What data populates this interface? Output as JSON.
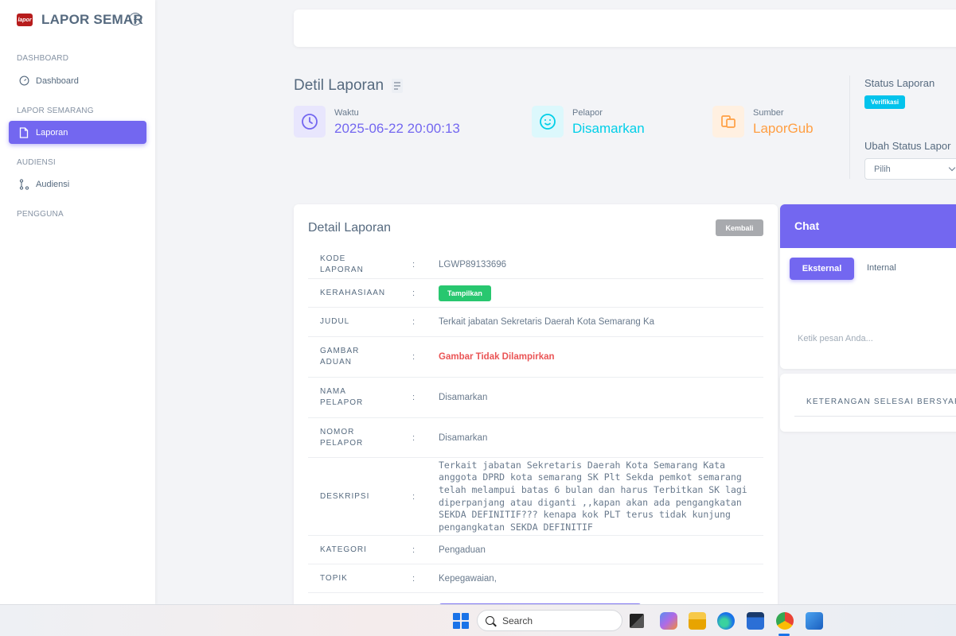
{
  "brand": {
    "name": "LAPOR SEMAR",
    "logo_text": "lapor"
  },
  "sidebar": {
    "sections": [
      {
        "header": "DASHBOARD",
        "items": [
          {
            "label": "Dashboard",
            "icon": "gauge-icon"
          }
        ]
      },
      {
        "header": "LAPOR SEMARANG",
        "items": [
          {
            "label": "Laporan",
            "icon": "file-icon",
            "active": true
          }
        ]
      },
      {
        "header": "AUDIENSI",
        "items": [
          {
            "label": "Audiensi",
            "icon": "nodes-icon"
          }
        ]
      },
      {
        "header": "PENGGUNA",
        "items": []
      }
    ]
  },
  "header": {
    "title": "Detil Laporan",
    "stats": [
      {
        "label": "Waktu",
        "value": "2025-06-22 20:00:13",
        "color": "#7367f0",
        "icon": "clock-icon"
      },
      {
        "label": "Pelapor",
        "value": "Disamarkan",
        "color": "#00cfe8",
        "icon": "smile-icon"
      },
      {
        "label": "Sumber",
        "value": "LaporGub",
        "color": "#ff9f43",
        "icon": "copy-icon"
      }
    ],
    "status_title": "Status Laporan",
    "status_badge": "Verifikasi",
    "ubah_status_title": "Ubah Status Lapor",
    "select_value": "Pilih"
  },
  "detail": {
    "title": "Detail Laporan",
    "back_button": "Kembali",
    "colon": ":",
    "rows": {
      "kode": {
        "label": "KODE LAPORAN",
        "value": "LGWP89133696"
      },
      "kerahasiaan": {
        "label": "KERAHASIAAN",
        "value": "Tampilkan"
      },
      "judul": {
        "label": "JUDUL",
        "value": "Terkait jabatan Sekretaris Daerah Kota Semarang Ka"
      },
      "gambar": {
        "label": "GAMBAR ADUAN",
        "value": "Gambar Tidak Dilampirkan"
      },
      "nama": {
        "label": "NAMA PELAPOR",
        "value": "Disamarkan"
      },
      "nomor": {
        "label": "NOMOR PELAPOR",
        "value": "Disamarkan"
      },
      "deskripsi": {
        "label": "DESKRIPSI",
        "value": "Terkait jabatan Sekretaris Daerah Kota Semarang Kata anggota DPRD kota semarang SK Plt Sekda pemkot semarang telah melampui batas 6 bulan dan harus Terbitkan SK lagi diperpanjang atau diganti ,,kapan akan ada pengangkatan SEKDA DEFINITIF??? kenapa kok PLT terus tidak kunjung pengangkatan SEKDA DEFINITIF"
      },
      "kategori": {
        "label": "KATEGORI",
        "value": "Pengaduan"
      },
      "topik": {
        "label": "TOPIK",
        "value": "Kepegawaian,"
      }
    }
  },
  "chat": {
    "title": "Chat",
    "tab_external": "Eksternal",
    "tab_internal": "Internal",
    "placeholder": "Ketik pesan Anda..."
  },
  "keterangan": {
    "title": "KETERANGAN SELESAI BERSYARAT"
  },
  "taskbar": {
    "search_label": "Search"
  }
}
